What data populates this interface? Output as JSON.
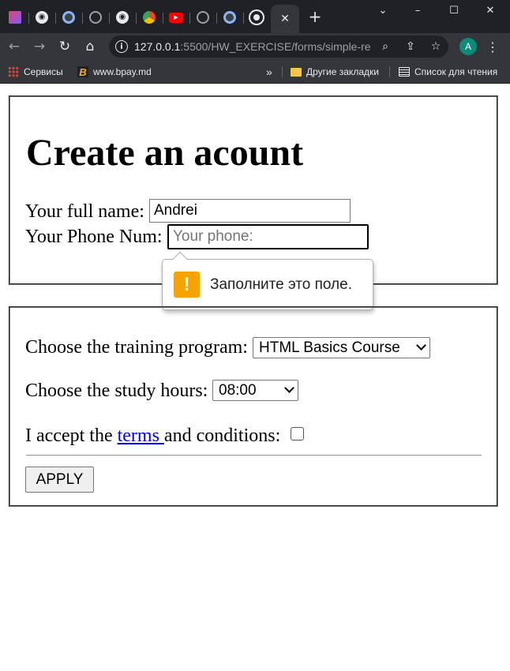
{
  "browser": {
    "tabs": [
      {
        "icon": "app-icon"
      },
      {
        "icon": "globe-icon"
      },
      {
        "icon": "circle-icon"
      },
      {
        "icon": "github-icon"
      },
      {
        "icon": "globe-icon"
      },
      {
        "icon": "colorful-icon"
      },
      {
        "icon": "youtube-icon"
      },
      {
        "icon": "github-icon"
      },
      {
        "icon": "circle-icon"
      },
      {
        "icon": "chrome-icon"
      }
    ],
    "active_tab_close": "✕",
    "new_tab": "+",
    "window_controls": {
      "dropdown": "⌄",
      "minimize": "–",
      "maximize": "☐",
      "close": "✕"
    },
    "nav": {
      "back": "←",
      "forward": "→",
      "reload": "↻",
      "home": "⌂"
    },
    "address": {
      "host": "127.0.0.1",
      "path": ":5500/HW_EXERCISE/forms/simple-re..."
    },
    "profile_initial": "A",
    "bookmarks": {
      "services": "Сервисы",
      "bpay": "www.bpay.md",
      "more": "»",
      "other": "Другие закладки",
      "reading_list": "Список для чтения"
    }
  },
  "form": {
    "title": "Create an acount",
    "full_name_label": "Your full name:",
    "full_name_value": "Andrei",
    "phone_label": "Your Phone Num:",
    "phone_placeholder": "Your phone:",
    "validation_message": "Заполните это поле.",
    "program_label": "Choose the training program:",
    "program_selected": "HTML Basics Course",
    "hours_label": "Choose the study hours:",
    "hours_selected": "08:00",
    "accept_prefix": "I accept the ",
    "terms_link": "terms ",
    "accept_suffix": "and conditions:",
    "terms_checked": false,
    "apply_label": "APPLY"
  },
  "colors": {
    "tabstrip": "#202124",
    "toolbar": "#35363a",
    "link": "#0000ee",
    "warning": "#f5a300",
    "profile": "#0f8a7a"
  }
}
